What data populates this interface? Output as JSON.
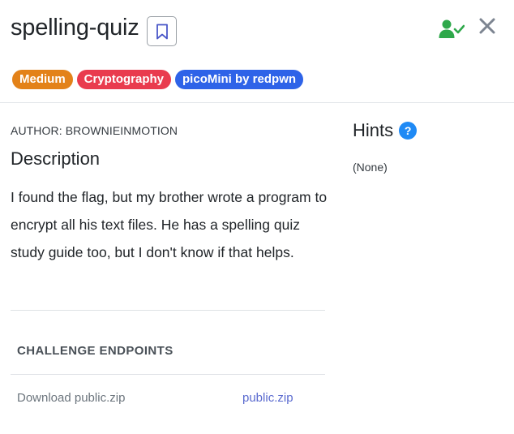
{
  "challenge": {
    "title": "spelling-quiz",
    "tags": [
      {
        "label": "Medium",
        "color": "#e38219"
      },
      {
        "label": "Cryptography",
        "color": "#e93b4e"
      },
      {
        "label": "picoMini by redpwn",
        "color": "#2e63e8"
      }
    ],
    "author": "AUTHOR: BROWNIEINMOTION",
    "description_heading": "Description",
    "description": "I found the flag, but my brother wrote a program to encrypt all his text files. He has a spelling quiz study guide too, but I don't know if that helps.",
    "endpoints_heading": "CHALLENGE ENDPOINTS",
    "endpoint": {
      "label": "Download public.zip",
      "link_text": "public.zip"
    }
  },
  "hints": {
    "heading": "Hints",
    "help_icon_text": "?",
    "value": "(None)"
  },
  "icons": {
    "bookmark": "bookmark-icon",
    "solved": "user-check-icon",
    "close": "close-icon",
    "help": "help-icon"
  },
  "colors": {
    "solved_green": "#2ea84a",
    "close_gray": "#7d8591",
    "link_blue": "#5a6acf",
    "help_blue": "#1f8af5"
  }
}
